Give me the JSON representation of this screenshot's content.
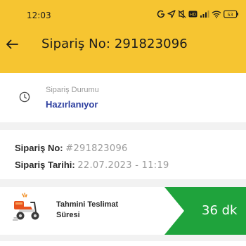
{
  "status_bar": {
    "time": "12:03",
    "battery": "53",
    "icons": [
      "google-icon",
      "location-icon",
      "mute-icon",
      "volte-icon",
      "signal-icon",
      "wifi-icon",
      "battery-icon"
    ]
  },
  "header": {
    "title": "Sipariş No: 291823096",
    "back_icon": "back-arrow-icon",
    "background": "#f6c531"
  },
  "order_status": {
    "label": "Sipariş Durumu",
    "value": "Hazırlanıyor",
    "icon": "clock-icon",
    "value_color": "#2b3d9f"
  },
  "order_info": {
    "number_label": "Sipariş No:",
    "number_value": "#291823096",
    "date_label": "Sipariş Tarihi:",
    "date_value": "22.07.2023 - 11:19"
  },
  "delivery": {
    "label": "Tahmini Teslimat Süresi",
    "time": "36 dk",
    "icon": "scooter-icon",
    "badge_color": "#1fa33c"
  }
}
